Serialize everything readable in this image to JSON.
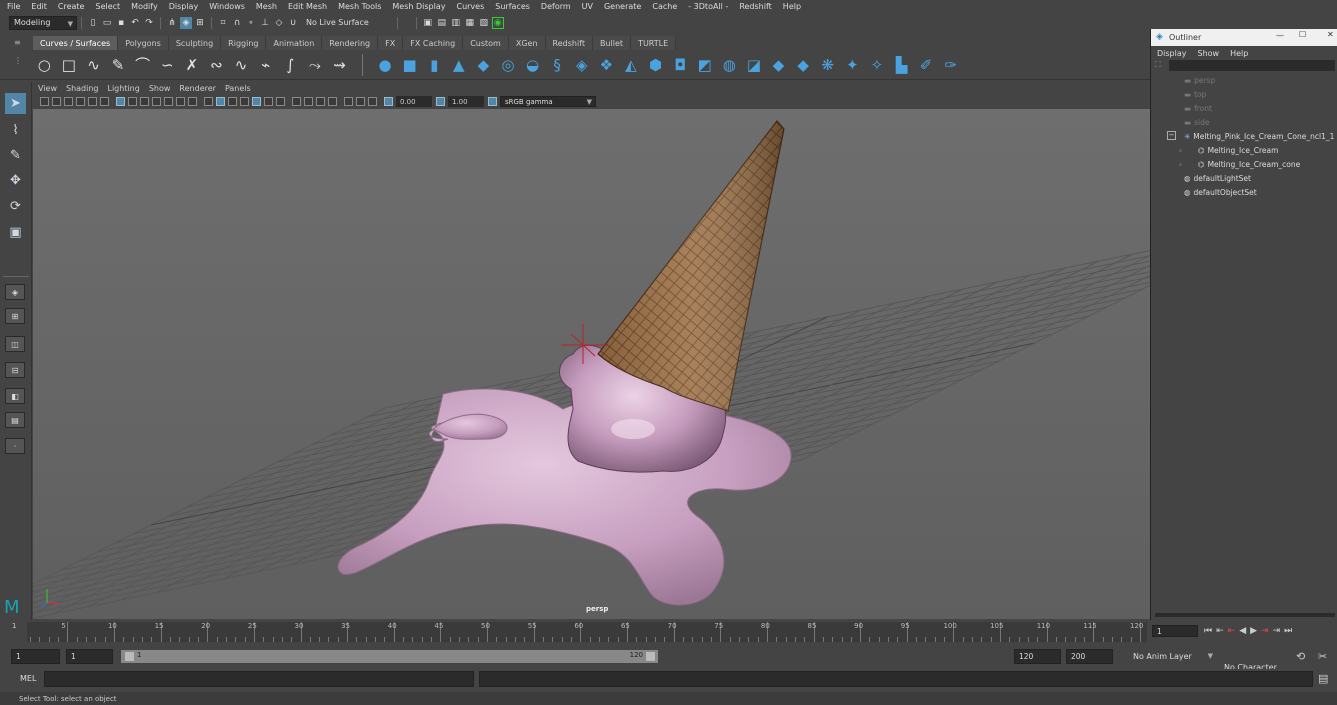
{
  "menus": [
    "File",
    "Edit",
    "Create",
    "Select",
    "Modify",
    "Display",
    "Windows",
    "Mesh",
    "Edit Mesh",
    "Mesh Tools",
    "Mesh Display",
    "Curves",
    "Surfaces",
    "Deform",
    "UV",
    "Generate",
    "Cache",
    "- 3DtoAll -",
    "Redshift",
    "Help"
  ],
  "status": {
    "menuset": "Modeling",
    "live_surface": "No Live Surface"
  },
  "shelf_tabs": [
    "Curves / Surfaces",
    "Polygons",
    "Sculpting",
    "Rigging",
    "Animation",
    "Rendering",
    "FX",
    "FX Caching",
    "Custom",
    "XGen",
    "Redshift",
    "Bullet",
    "TURTLE"
  ],
  "viewport": {
    "menus": [
      "View",
      "Shading",
      "Lighting",
      "Show",
      "Renderer",
      "Panels"
    ],
    "exposure": "0.00",
    "gamma": "1.00",
    "color_space": "sRGB gamma",
    "camera_label": "persp"
  },
  "outliner": {
    "title": "Outliner",
    "menus": [
      "Display",
      "Show",
      "Help"
    ],
    "rows": [
      {
        "label": "persp"
      },
      {
        "label": "top"
      },
      {
        "label": "front"
      },
      {
        "label": "side"
      },
      {
        "label": "Melting_Pink_Ice_Cream_Cone_ncl1_1"
      },
      {
        "label": "Melting_Ice_Cream"
      },
      {
        "label": "Melting_Ice_Cream_cone"
      },
      {
        "label": "defaultLightSet"
      },
      {
        "label": "defaultObjectSet"
      }
    ]
  },
  "timeline": {
    "ticks": [
      "5",
      "10",
      "15",
      "20",
      "25",
      "30",
      "35",
      "40",
      "45",
      "50",
      "55",
      "60",
      "65",
      "70",
      "75",
      "80",
      "85",
      "90",
      "95",
      "100",
      "105",
      "110",
      "115",
      "120"
    ],
    "current_frame": "1",
    "first": "1"
  },
  "range": {
    "start": "1",
    "start_inner": "1",
    "bar_start": "1",
    "bar_end": "120",
    "end_inner": "120",
    "end": "200",
    "anim_layer": "No Anim Layer",
    "char_set": "No Character Set"
  },
  "cmd": {
    "label": "MEL"
  },
  "help": "Select Tool: select an object",
  "colors": {
    "accent": "#5285a6",
    "ice_cream": "#c9a2c3",
    "cone": "#a8794a",
    "grid": "#5a5a5a"
  }
}
